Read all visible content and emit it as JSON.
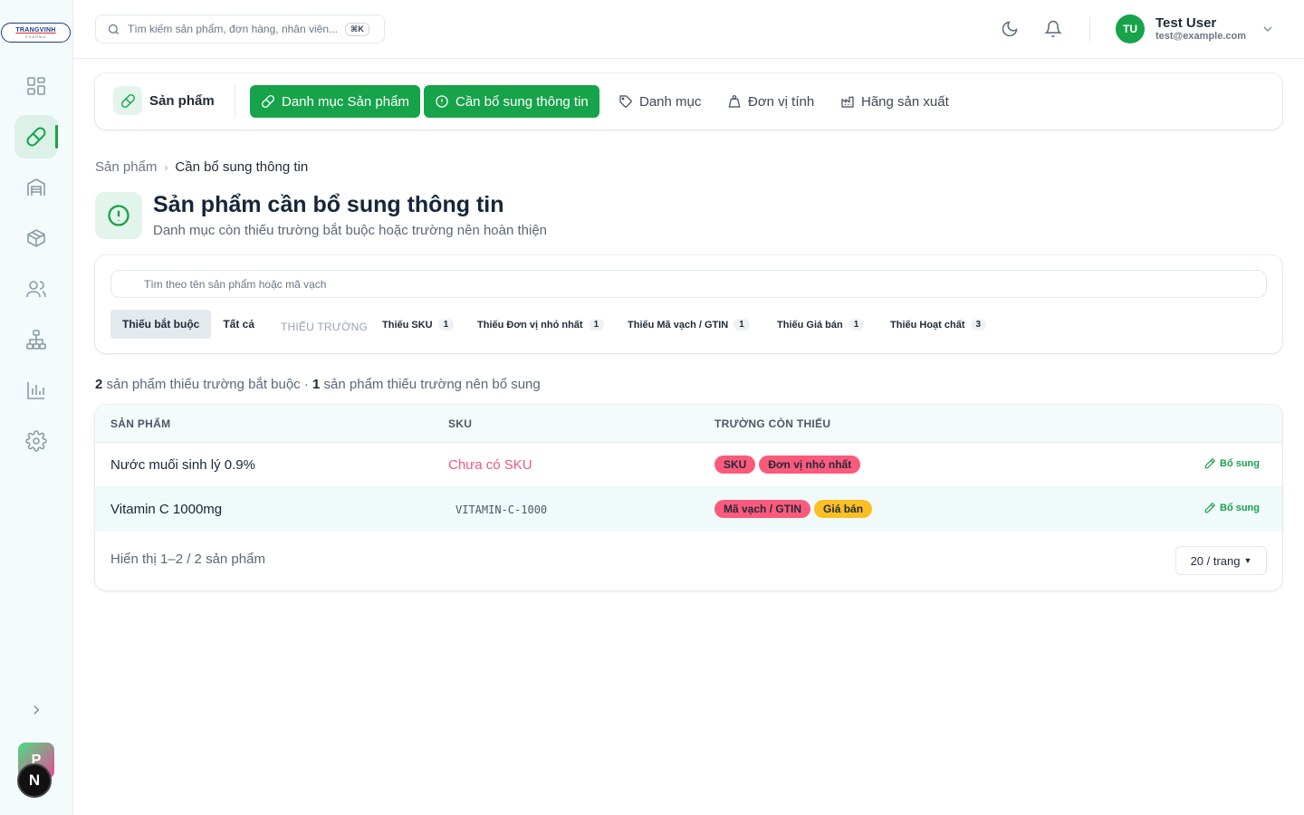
{
  "logo": {
    "text": "TRANGVINH",
    "sub": "PHARMA"
  },
  "sidebar": {
    "items": [
      {
        "name": "dashboard-icon"
      },
      {
        "name": "pill-icon",
        "active": true
      },
      {
        "name": "warehouse-icon"
      },
      {
        "name": "box-icon"
      },
      {
        "name": "users-icon"
      },
      {
        "name": "hierarchy-icon"
      },
      {
        "name": "chart-icon"
      },
      {
        "name": "gear-icon"
      }
    ],
    "avatar_p": "P",
    "avatar_n": "N"
  },
  "header": {
    "search_placeholder": "Tìm kiếm sản phẩm, đơn hàng, nhân viên...",
    "shortcut": "⌘K",
    "user": {
      "initials": "TU",
      "name": "Test User",
      "email": "test@example.com"
    }
  },
  "tabs": {
    "title": "Sản phẩm",
    "items": [
      {
        "label": "Danh mục Sản phẩm",
        "active": true
      },
      {
        "label": "Cần bổ sung thông tin",
        "active": true
      },
      {
        "label": "Danh mục",
        "active": false
      },
      {
        "label": "Đơn vị tính",
        "active": false
      },
      {
        "label": "Hãng sản xuất",
        "active": false
      }
    ]
  },
  "breadcrumb": {
    "parent": "Sản phẩm",
    "current": "Cần bổ sung thông tin"
  },
  "page": {
    "title": "Sản phẩm cần bổ sung thông tin",
    "subtitle": "Danh mục còn thiếu trường bắt buộc hoặc trường nên hoàn thiện"
  },
  "filters": {
    "search_placeholder": "Tìm theo tên sản phẩm hoặc mã vạch",
    "segments": [
      "Thiếu bắt buộc",
      "Tất cả"
    ],
    "missing_label": "THIẾU TRƯỜNG",
    "chips": [
      {
        "label": "Thiếu SKU",
        "count": "1"
      },
      {
        "label": "Thiếu Đơn vị nhỏ nhất",
        "count": "1"
      },
      {
        "label": "Thiếu Mã vạch / GTIN",
        "count": "1"
      },
      {
        "label": "Thiếu Giá bán",
        "count": "1"
      },
      {
        "label": "Thiếu Hoạt chất",
        "count": "3"
      }
    ]
  },
  "summary": {
    "required_count": "2",
    "required_text": " sản phẩm thiếu trường bắt buộc · ",
    "optional_count": "1",
    "optional_text": " sản phẩm thiếu trường nên bổ sung"
  },
  "table": {
    "headers": [
      "SẢN PHẨM",
      "SKU",
      "TRƯỜNG CÒN THIẾU"
    ],
    "rows": [
      {
        "name": "Nước muối sinh lý 0.9%",
        "sku": "Chưa có SKU",
        "tags": [
          "SKU",
          "Đơn vị nhỏ nhất"
        ],
        "action": "Bổ sung"
      },
      {
        "name": "Vitamin C 1000mg",
        "sku": "VITAMIN-C-1000",
        "tags": [
          "Mã vạch / GTIN",
          "Giá bán"
        ],
        "action": "Bổ sung"
      }
    ],
    "footer": "Hiển thị 1–2 / 2 sản phẩm",
    "page_size": "20 / trang"
  },
  "colors": {
    "accent": "#16a34a",
    "danger": "#fb5a7c",
    "warning": "#fbbf24"
  }
}
